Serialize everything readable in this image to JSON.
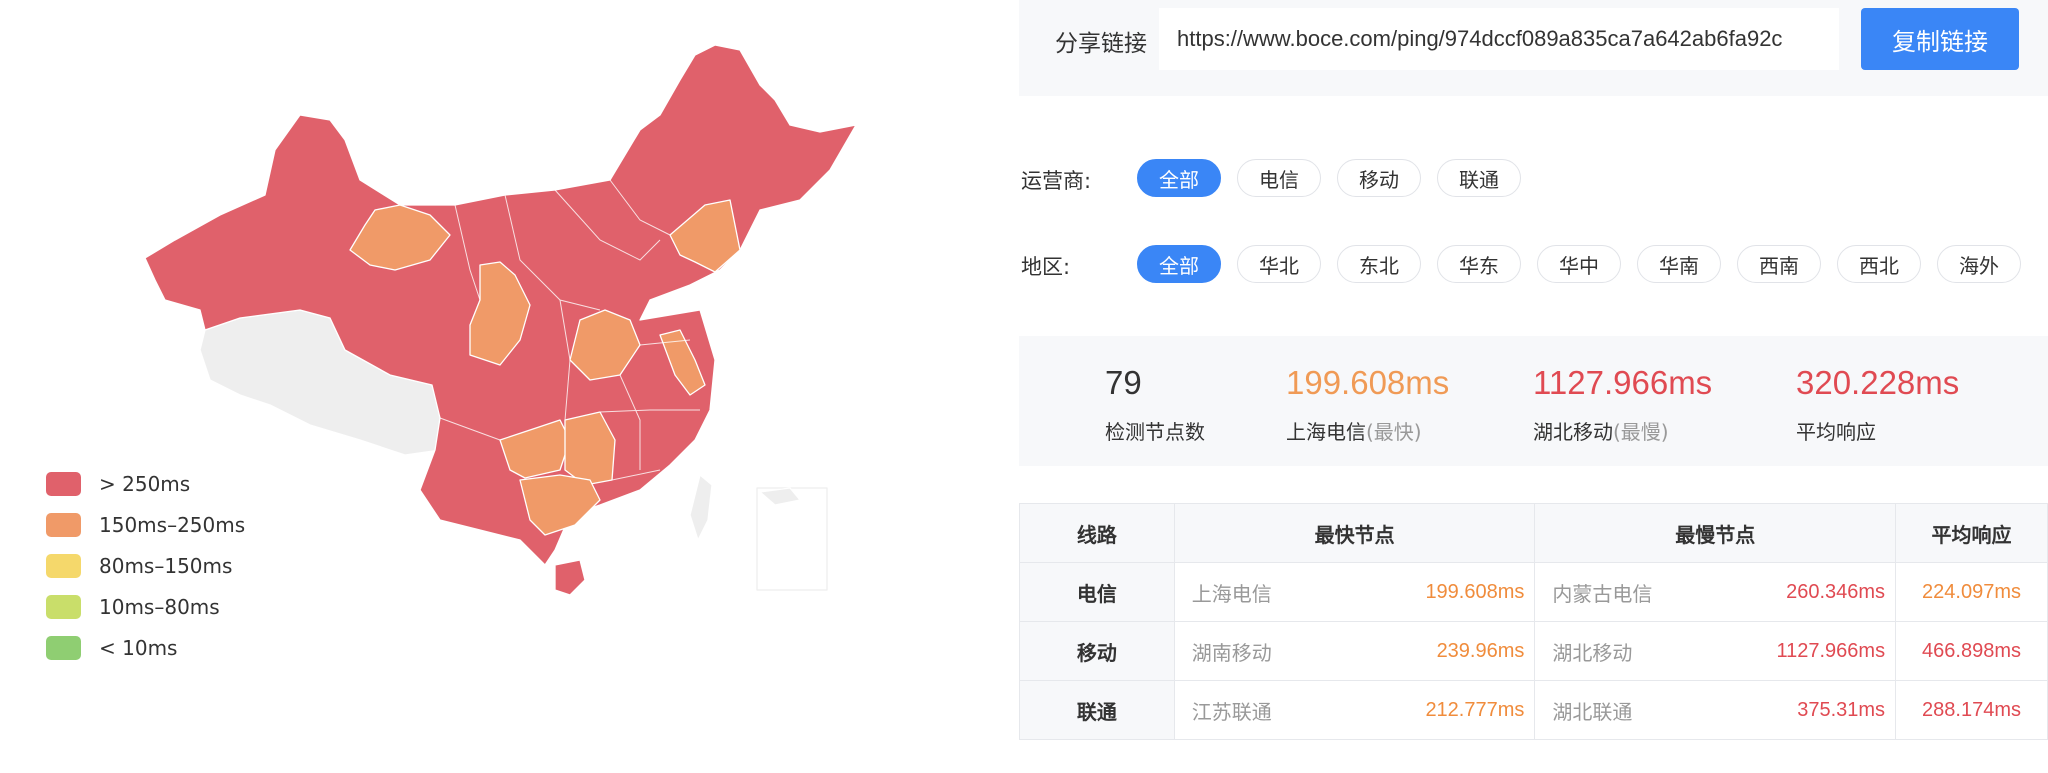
{
  "colors": {
    "accent": "#3a86f6",
    "severe": "#e0616b",
    "high": "#f09a68",
    "medium": "#f5d86b",
    "low": "#c9de6a",
    "best": "#8fce72",
    "nodata": "#eeeeee",
    "fast_text": "#f08c3c",
    "slow_text": "#e04a52"
  },
  "legend": [
    {
      "label": "> 250ms",
      "color": "#e0616b"
    },
    {
      "label": "150ms–250ms",
      "color": "#f09a68"
    },
    {
      "label": "80ms–150ms",
      "color": "#f5d86b"
    },
    {
      "label": "10ms–80ms",
      "color": "#c9de6a"
    },
    {
      "label": "< 10ms",
      "color": "#8fce72"
    }
  ],
  "share": {
    "label": "分享链接",
    "url": "https://www.boce.com/ping/974dccf089a835ca7a642ab6fa92c",
    "copy_label": "复制链接"
  },
  "filters": {
    "operator_label": "运营商:",
    "operators": [
      "全部",
      "电信",
      "移动",
      "联通"
    ],
    "operator_selected": "全部",
    "region_label": "地区:",
    "regions": [
      "全部",
      "华北",
      "东北",
      "华东",
      "华中",
      "华南",
      "西南",
      "西北",
      "海外"
    ],
    "region_selected": "全部"
  },
  "stats": {
    "node_count": "79",
    "node_count_label": "检测节点数",
    "fastest_value": "199.608ms",
    "fastest_label": "上海电信",
    "fastest_tag": "(最快)",
    "slowest_value": "1127.966ms",
    "slowest_label": "湖北移动",
    "slowest_tag": "(最慢)",
    "average_value": "320.228ms",
    "average_label": "平均响应"
  },
  "table": {
    "headers": [
      "线路",
      "最快节点",
      "最慢节点",
      "平均响应"
    ],
    "rows": [
      {
        "line": "电信",
        "fast_node": "上海电信",
        "fast_ms": "199.608ms",
        "slow_node": "内蒙古电信",
        "slow_ms": "260.346ms",
        "avg_ms": "224.097ms"
      },
      {
        "line": "移动",
        "fast_node": "湖南移动",
        "fast_ms": "239.96ms",
        "slow_node": "湖北移动",
        "slow_ms": "1127.966ms",
        "avg_ms": "466.898ms"
      },
      {
        "line": "联通",
        "fast_node": "江苏联通",
        "fast_ms": "212.777ms",
        "slow_node": "湖北联通",
        "slow_ms": "375.31ms",
        "avg_ms": "288.174ms"
      }
    ]
  }
}
